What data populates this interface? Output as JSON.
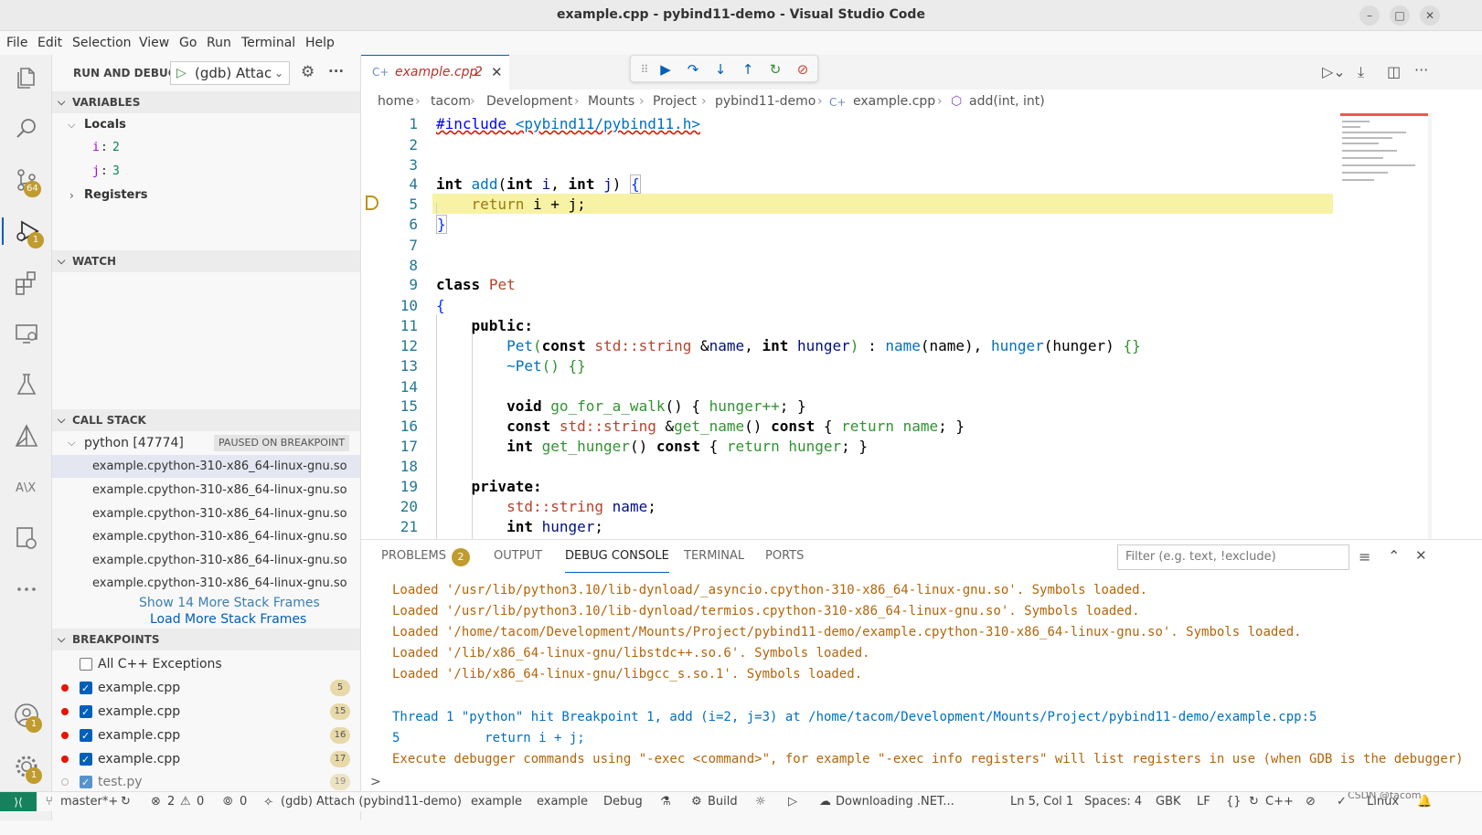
{
  "window": {
    "title": "example.cpp - pybind11-demo - Visual Studio Code"
  },
  "menu": [
    "File",
    "Edit",
    "Selection",
    "View",
    "Go",
    "Run",
    "Terminal",
    "Help"
  ],
  "activity": {
    "scm_badge": "64",
    "debug_badge": "1",
    "accounts_badge": "1",
    "manage_badge": "1"
  },
  "sidebar": {
    "title": "RUN AND DEBUG",
    "config": "(gdb) Attac",
    "variables": {
      "header": "VARIABLES",
      "locals_label": "Locals",
      "locals": [
        {
          "name": "i",
          "value": "2"
        },
        {
          "name": "j",
          "value": "3"
        }
      ],
      "registers_label": "Registers"
    },
    "watch": {
      "header": "WATCH"
    },
    "call_stack": {
      "header": "CALL STACK",
      "thread": "python [47774]",
      "status": "PAUSED ON BREAKPOINT",
      "frames": [
        "example.cpython-310-x86_64-linux-gnu.so",
        "example.cpython-310-x86_64-linux-gnu.so",
        "example.cpython-310-x86_64-linux-gnu.so",
        "example.cpython-310-x86_64-linux-gnu.so",
        "example.cpython-310-x86_64-linux-gnu.so",
        "example.cpython-310-x86_64-linux-gnu.so"
      ],
      "show_more": "Show 14 More Stack Frames",
      "load_more": "Load More Stack Frames"
    },
    "breakpoints": {
      "header": "BREAKPOINTS",
      "items": [
        {
          "label": "All C++ Exceptions",
          "checked": false,
          "dot": "none",
          "line": ""
        },
        {
          "label": "example.cpp",
          "checked": true,
          "dot": "red",
          "line": "5"
        },
        {
          "label": "example.cpp",
          "checked": true,
          "dot": "red",
          "line": "15"
        },
        {
          "label": "example.cpp",
          "checked": true,
          "dot": "red",
          "line": "16"
        },
        {
          "label": "example.cpp",
          "checked": true,
          "dot": "red",
          "line": "17"
        },
        {
          "label": "test.py",
          "checked": true,
          "dot": "hollow",
          "line": "19"
        }
      ]
    }
  },
  "editor": {
    "tab": {
      "label": "example.cpp",
      "problems": "2"
    },
    "breadcrumb": [
      "home",
      "tacom",
      "Development",
      "Mounts",
      "Project",
      "pybind11-demo",
      "example.cpp",
      "add(int, int)"
    ],
    "line_numbers": [
      "1",
      "2",
      "3",
      "4",
      "5",
      "6",
      "7",
      "8",
      "9",
      "10",
      "11",
      "12",
      "13",
      "14",
      "15",
      "16",
      "17",
      "18",
      "19",
      "20",
      "21"
    ],
    "current_line": "5"
  },
  "panel": {
    "tabs": {
      "problems": "PROBLEMS",
      "problems_count": "2",
      "output": "OUTPUT",
      "debug_console": "DEBUG CONSOLE",
      "terminal": "TERMINAL",
      "ports": "PORTS"
    },
    "filter_placeholder": "Filter (e.g. text, !exclude)",
    "lines": [
      "Loaded '/usr/lib/python3.10/lib-dynload/_asyncio.cpython-310-x86_64-linux-gnu.so'. Symbols loaded.",
      "Loaded '/usr/lib/python3.10/lib-dynload/termios.cpython-310-x86_64-linux-gnu.so'. Symbols loaded.",
      "Loaded '/home/tacom/Development/Mounts/Project/pybind11-demo/example.cpython-310-x86_64-linux-gnu.so'. Symbols loaded.",
      "Loaded '/lib/x86_64-linux-gnu/libstdc++.so.6'. Symbols loaded.",
      "Loaded '/lib/x86_64-linux-gnu/libgcc_s.so.1'. Symbols loaded.",
      "Thread 1 \"python\" hit Breakpoint 1, add (i=2, j=3) at /home/tacom/Development/Mounts/Project/pybind11-demo/example.cpp:5",
      "5           return i + j;",
      "Execute debugger commands using \"-exec <command>\", for example \"-exec info registers\" will list registers in use (when GDB is the debugger)"
    ],
    "prompt": ">"
  },
  "statusbar": {
    "branch": "master*+",
    "errors": "2",
    "warnings": "0",
    "ports": "0",
    "debug_config": "(gdb) Attach (pybind11-demo)",
    "target1": "example",
    "target2": "example",
    "build_type": "Debug",
    "build": "Build",
    "downloading": "Downloading .NET...",
    "position": "Ln 5, Col 1",
    "spaces": "Spaces: 4",
    "encoding": "GBK",
    "eol": "LF",
    "braces": "{}",
    "language": "C++",
    "platform": "Linux",
    "watermark": "CSDN @tacom"
  }
}
